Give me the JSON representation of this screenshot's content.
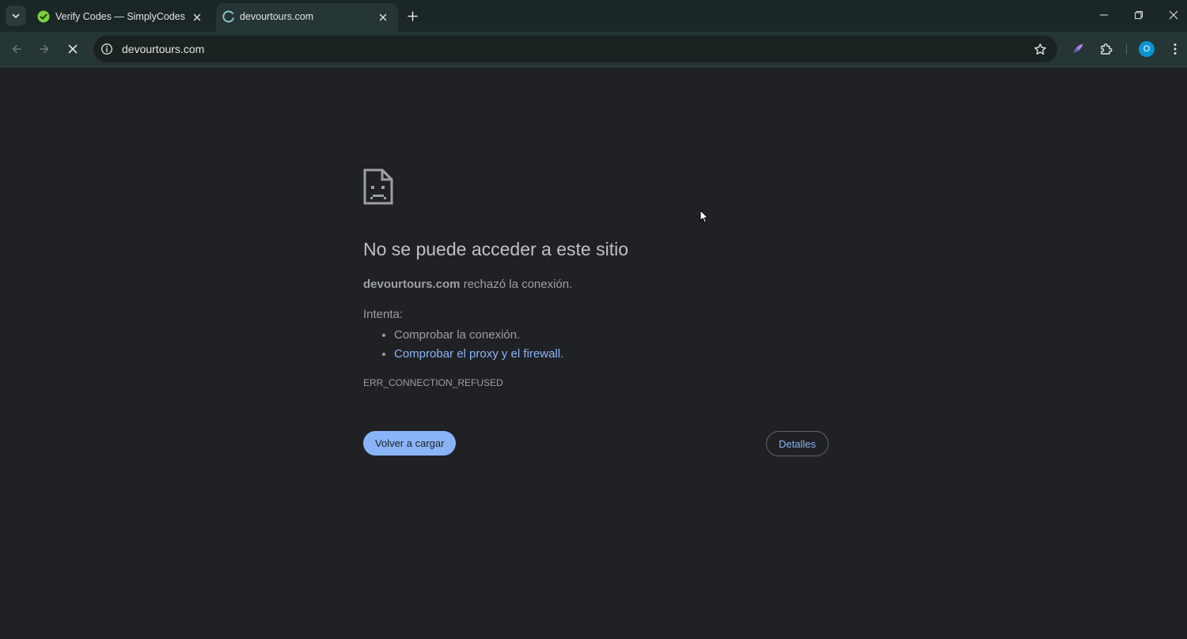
{
  "browser": {
    "tabs": [
      {
        "title": "Verify Codes — SimplyCodes",
        "active": false,
        "favicon": "simplycodes-icon"
      },
      {
        "title": "devourtours.com",
        "active": true,
        "favicon": "loading-spinner-icon"
      }
    ],
    "address_bar": {
      "url": "devourtours.com"
    },
    "profile_initial": "O",
    "colors": {
      "tabstrip": "#1b2727",
      "toolbar": "#263636",
      "omnibox": "#1a2222",
      "accent": "#8ab4f8",
      "avatar": "#0b93d0"
    }
  },
  "error_page": {
    "heading": "No se puede acceder a este sitio",
    "host": "devourtours.com",
    "description_suffix": " rechazó la conexión.",
    "try_label": "Intenta:",
    "suggestions": [
      {
        "text": "Comprobar la conexión.",
        "link": false
      },
      {
        "text": "Comprobar el proxy y el firewall",
        "link": true,
        "suffix": "."
      }
    ],
    "error_code": "ERR_CONNECTION_REFUSED",
    "reload_label": "Volver a cargar",
    "details_label": "Detalles",
    "icon": "sad-page-icon"
  }
}
